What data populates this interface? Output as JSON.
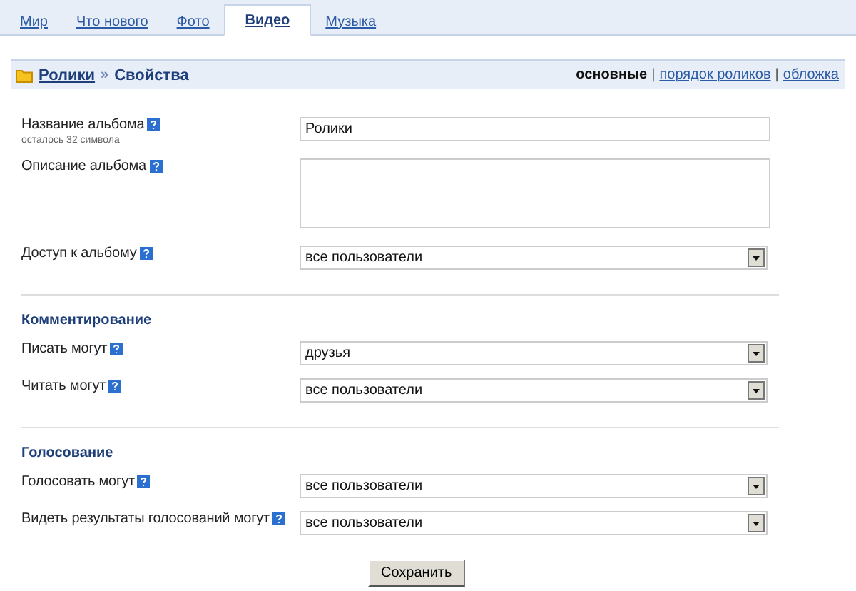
{
  "tabs": [
    {
      "label": "Мир",
      "selected": false
    },
    {
      "label": "Что нового",
      "selected": false
    },
    {
      "label": "Фото",
      "selected": false
    },
    {
      "label": "Видео",
      "selected": true
    },
    {
      "label": "Музыка",
      "selected": false
    }
  ],
  "breadcrumb": {
    "parent": "Ролики",
    "separator": "»",
    "current": "Свойства"
  },
  "view_link_separator": "|",
  "view_links": [
    {
      "label": "основные",
      "selected": true
    },
    {
      "label": "порядок роликов",
      "selected": false
    },
    {
      "label": "обложка",
      "selected": false
    }
  ],
  "sections": [
    {
      "fields": [
        {
          "kind": "text",
          "label": "Название альбома",
          "hint": "осталось 32 символа",
          "value": "Ролики"
        },
        {
          "kind": "textarea",
          "label": "Описание альбома"
        },
        {
          "kind": "select",
          "label": "Доступ к альбому",
          "value": "все пользователи"
        }
      ]
    },
    {
      "title": "Комментирование",
      "fields": [
        {
          "kind": "select",
          "label": "Писать могут",
          "value": "друзья"
        },
        {
          "kind": "select",
          "label": "Читать могут",
          "value": "все пользователи"
        }
      ]
    },
    {
      "title": "Голосование",
      "fields": [
        {
          "kind": "select",
          "label": "Голосовать могут",
          "value": "все пользователи"
        },
        {
          "kind": "select",
          "label": "Видеть результаты голосований могут",
          "value": "все пользователи"
        }
      ]
    }
  ],
  "save_button": "Сохранить"
}
